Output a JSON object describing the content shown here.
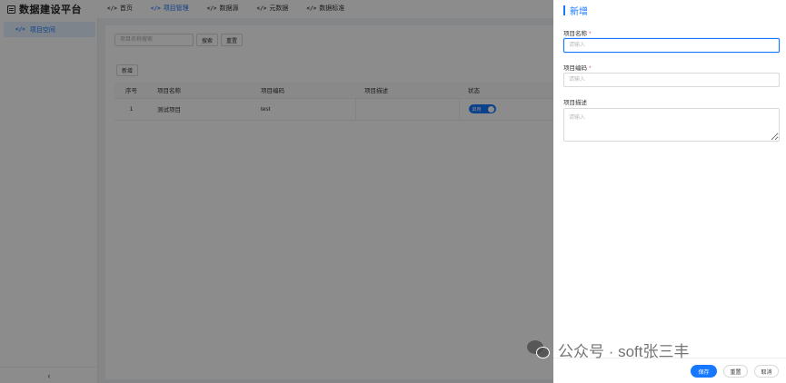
{
  "header": {
    "brand_title": "数据建设平台",
    "brand_icon": "grid-icon",
    "nav": [
      {
        "label": "首页",
        "active": false
      },
      {
        "label": "项目管理",
        "active": true
      },
      {
        "label": "数据源",
        "active": false
      },
      {
        "label": "元数据",
        "active": false
      },
      {
        "label": "数据标准",
        "active": false
      }
    ]
  },
  "sidebar": {
    "items": [
      {
        "label": "项目空间",
        "active": true
      }
    ],
    "collapse_icon": "‹"
  },
  "search": {
    "placeholder": "项目名称搜索",
    "search_label": "搜索",
    "reset_label": "重置"
  },
  "toolbar": {
    "add_label": "新增"
  },
  "table": {
    "columns": [
      "序号",
      "项目名称",
      "项目编码",
      "项目描述",
      "状态"
    ],
    "rows": [
      {
        "index": "1",
        "name": "测试项目",
        "code": "test",
        "desc": "",
        "status": "启用"
      }
    ]
  },
  "drawer": {
    "title": "新增",
    "fields": {
      "name": {
        "label": "项目名称",
        "required_mark": "*",
        "placeholder": "请输入",
        "value": ""
      },
      "code": {
        "label": "项目编码",
        "required_mark": "*",
        "placeholder": "请输入",
        "value": ""
      },
      "desc": {
        "label": "项目描述",
        "placeholder": "请输入",
        "value": ""
      }
    },
    "footer": {
      "save_label": "保存",
      "reset_label": "重置",
      "cancel_label": "取消"
    }
  },
  "watermark": {
    "text": "公众号 · soft张三丰"
  },
  "colors": {
    "accent": "#1677ff",
    "required": "#ff4d4f",
    "overlay": "rgba(0,0,0,0.45)"
  }
}
